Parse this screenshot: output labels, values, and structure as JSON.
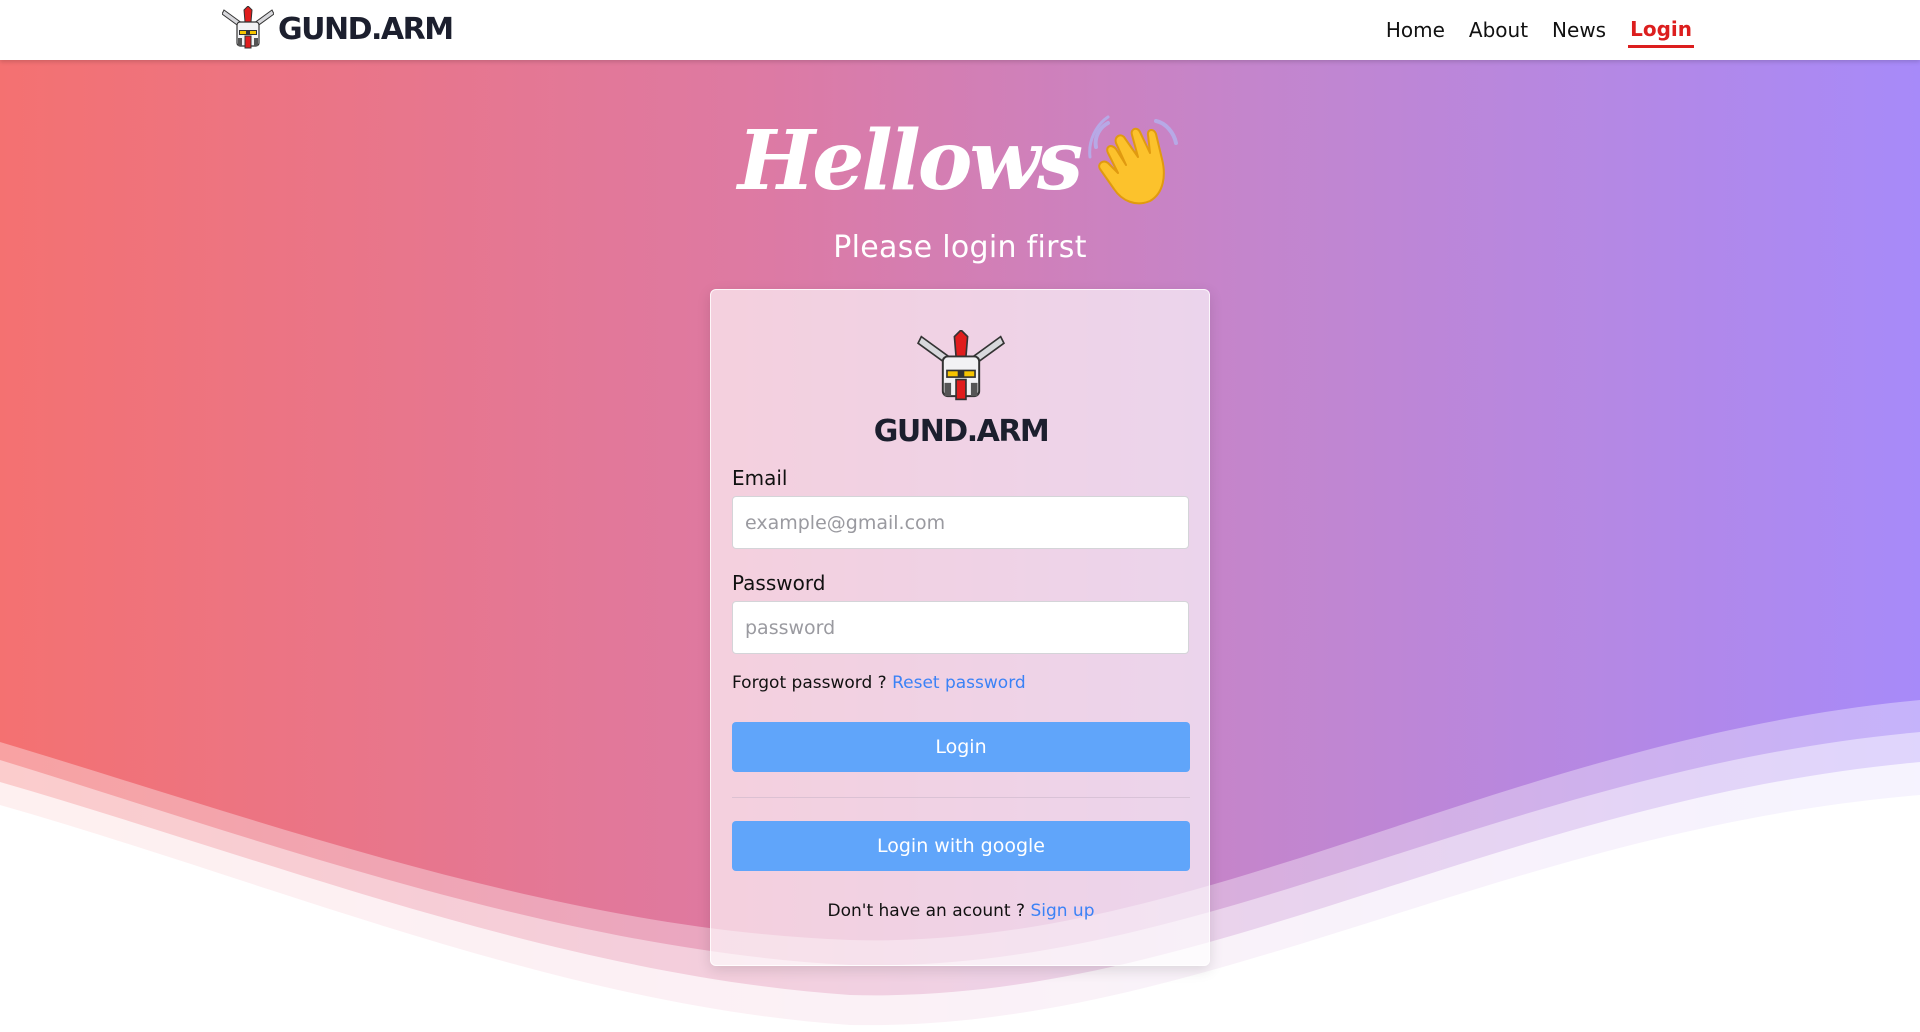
{
  "navbar": {
    "brand": "GUND.ARM",
    "links": [
      {
        "label": "Home"
      },
      {
        "label": "About"
      },
      {
        "label": "News"
      },
      {
        "label": "Login",
        "active": true
      }
    ]
  },
  "hero": {
    "greeting": "Hellows",
    "greeting_emoji": "waving-hand-icon",
    "subtitle": "Please login first"
  },
  "login_card": {
    "brand": "GUND.ARM",
    "email": {
      "label": "Email",
      "placeholder": "example@gmail.com",
      "value": ""
    },
    "password": {
      "label": "Password",
      "placeholder": "password",
      "value": ""
    },
    "forgot_text": "Forgot password ?",
    "reset_link": "Reset password",
    "login_button": "Login",
    "google_button": "Login with google",
    "signup_text": "Don't have an acount ?",
    "signup_link": "Sign up"
  },
  "colors": {
    "accent_red": "#dc1e1e",
    "button_blue": "#60a5fa",
    "link_blue": "#3b82f6",
    "gradient_left": "#f47171",
    "gradient_right": "#a78af9"
  }
}
